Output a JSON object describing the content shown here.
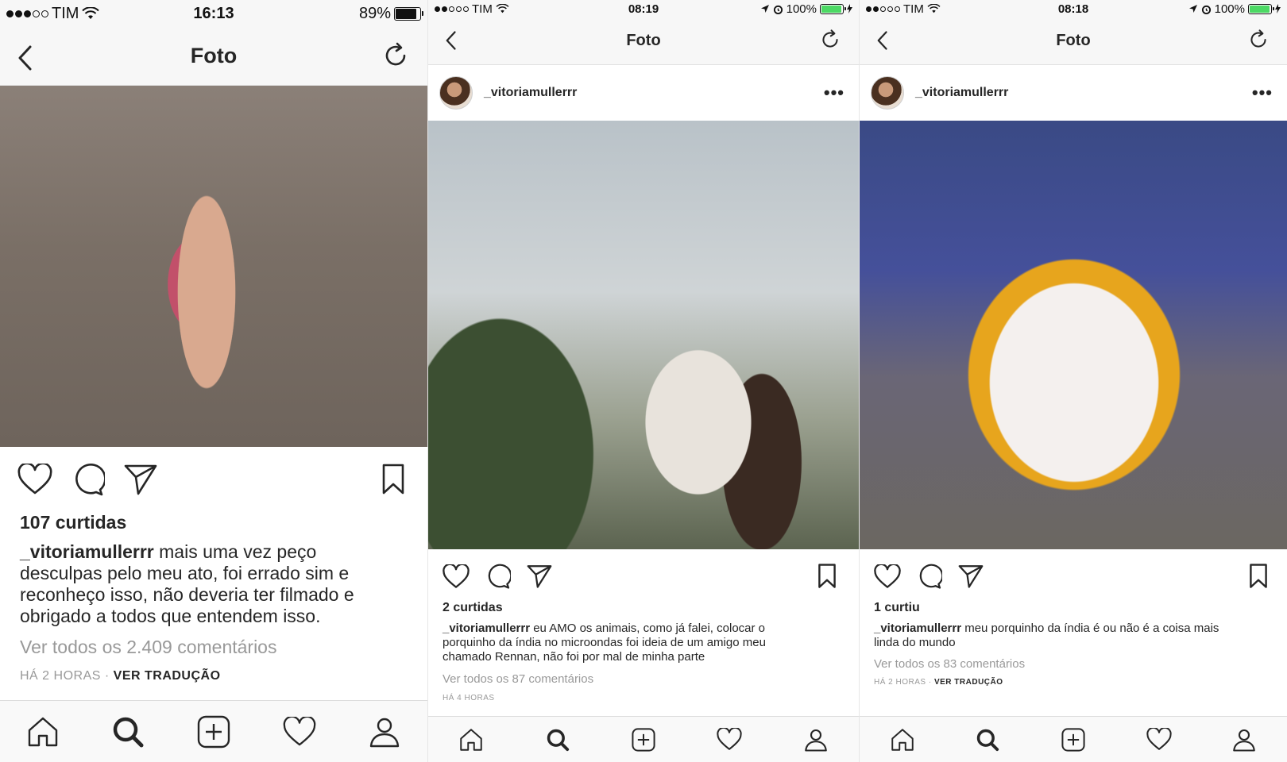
{
  "screens": [
    {
      "status": {
        "carrier": "TIM",
        "time": "16:13",
        "battery": "89%",
        "battery_level": 0.89,
        "battery_color": "#111111"
      },
      "nav": {
        "title": "Foto"
      },
      "likes": "107 curtidas",
      "caption": {
        "username": "_vitoriamullerrr",
        "text": " mais uma vez peço desculpas pelo meu ato, foi errado sim e reconheço isso, não deveria ter filmado e obrigado a todos que entendem isso."
      },
      "view_comments": "Ver todos os 2.409 comentários",
      "time_ago": "HÁ 2 HORAS",
      "separator": " · ",
      "translate": "VER TRADUÇÃO"
    },
    {
      "status": {
        "carrier": "TIM",
        "time": "08:19",
        "battery": "100%",
        "battery_level": 1.0,
        "battery_color": "#4cd964"
      },
      "nav": {
        "title": "Foto"
      },
      "header": {
        "username": "_vitoriamullerrr",
        "more": "•••"
      },
      "likes": "2 curtidas",
      "caption": {
        "username": "_vitoriamullerrr",
        "text": " eu AMO os animais, como já falei, colocar o porquinho da índia no microondas foi ideia de um amigo meu chamado Rennan, não foi por mal de minha parte"
      },
      "view_comments": "Ver todos os 87 comentários",
      "time_ago": "HÁ 4 HORAS"
    },
    {
      "status": {
        "carrier": "TIM",
        "time": "08:18",
        "battery": "100%",
        "battery_level": 1.0,
        "battery_color": "#4cd964"
      },
      "nav": {
        "title": "Foto"
      },
      "header": {
        "username": "_vitoriamullerrr",
        "more": "•••"
      },
      "likes": "1 curtiu",
      "caption": {
        "username": "_vitoriamullerrr",
        "text": " meu porquinho da índia é ou não é a coisa mais linda do mundo"
      },
      "view_comments": "Ver todos os 83 comentários",
      "time_ago": "HÁ 2 HORAS",
      "separator": " · ",
      "translate": "VER TRADUÇÃO"
    }
  ],
  "icons": {
    "back": "chevron-left-icon",
    "refresh": "refresh-icon",
    "like": "heart-icon",
    "comment": "comment-bubble-icon",
    "share": "send-icon",
    "save": "bookmark-icon",
    "tabs": [
      "home-icon",
      "search-icon",
      "add-post-icon",
      "activity-heart-icon",
      "profile-icon"
    ]
  },
  "colors": {
    "text": "#262626",
    "muted": "#999999",
    "battery_green": "#4cd964"
  }
}
